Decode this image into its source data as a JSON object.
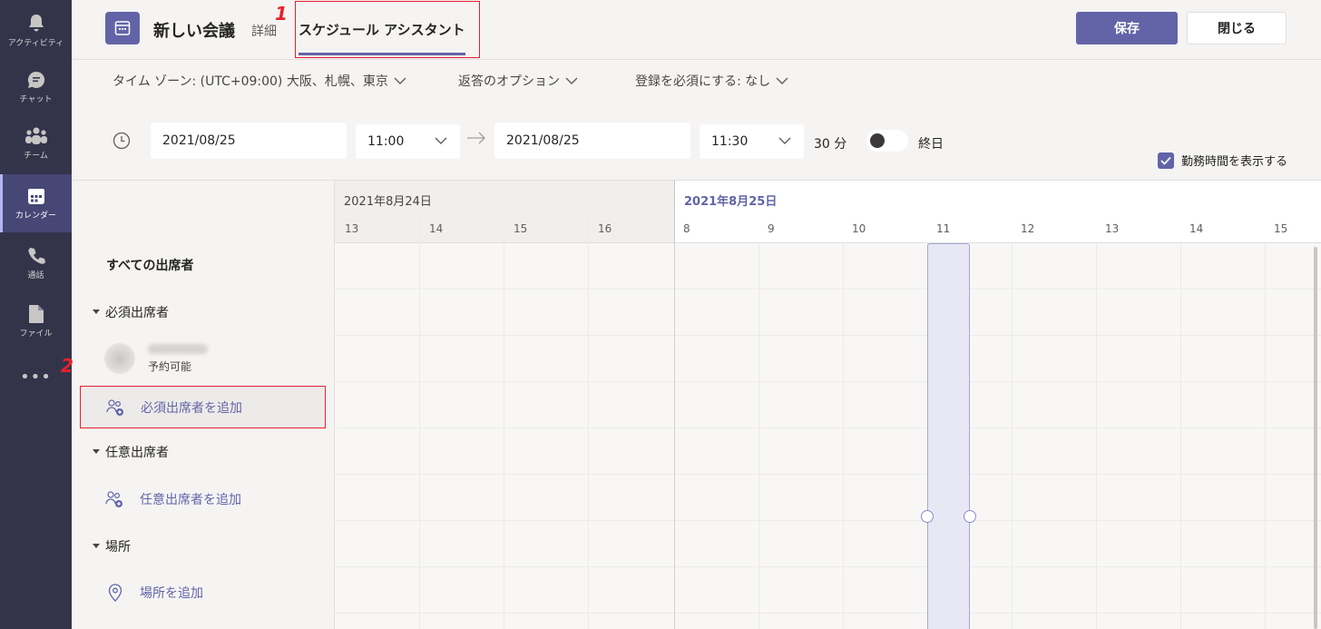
{
  "rail": {
    "items": [
      {
        "label": "アクティビティ",
        "icon": "bell-icon"
      },
      {
        "label": "チャット",
        "icon": "chat-icon"
      },
      {
        "label": "チーム",
        "icon": "teams-icon"
      },
      {
        "label": "カレンダー",
        "icon": "calendar-icon",
        "active": true
      },
      {
        "label": "通話",
        "icon": "phone-icon"
      },
      {
        "label": "ファイル",
        "icon": "file-icon"
      }
    ],
    "more": "•••"
  },
  "header": {
    "title": "新しい会議",
    "tab_details": "詳細",
    "tab_scheduling": "スケジュール アシスタント",
    "save_label": "保存",
    "close_label": "閉じる"
  },
  "annotations": {
    "marker1": "1",
    "marker2": "2"
  },
  "options": {
    "timezone": "タイム ゾーン: (UTC+09:00) 大阪、札幌、東京",
    "response": "返答のオプション",
    "registration": "登録を必須にする: なし"
  },
  "datetime": {
    "start_date": "2021/08/25",
    "start_time": "11:00",
    "end_date": "2021/08/25",
    "end_time": "11:30",
    "duration": "30 分",
    "all_day": "終日",
    "work_hours": "勤務時間を表示する"
  },
  "grid": {
    "day1_label": "2021年8月24日",
    "day2_label": "2021年8月25日",
    "day1_hours": [
      "13",
      "14",
      "15",
      "16"
    ],
    "day2_hours": [
      "8",
      "9",
      "10",
      "11",
      "12",
      "13",
      "14",
      "15"
    ]
  },
  "attendees": {
    "all": "すべての出席者",
    "required_section": "必須出席者",
    "attendee_status": "予約可能",
    "add_required": "必須出席者を追加",
    "optional_section": "任意出席者",
    "add_optional": "任意出席者を追加",
    "location_section": "場所",
    "add_location": "場所を追加"
  },
  "colors": {
    "accent": "#6264a7",
    "rail": "#33344a",
    "highlight": "#e8202a"
  }
}
